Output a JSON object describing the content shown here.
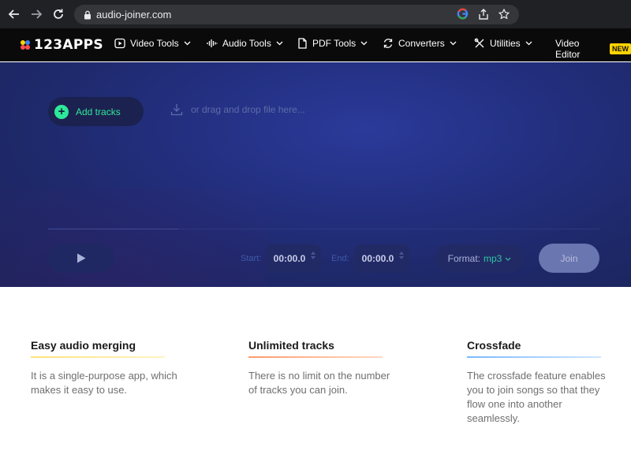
{
  "browser": {
    "url": "audio-joiner.com",
    "icons": [
      "back-arrow-icon",
      "forward-arrow-icon",
      "reload-icon",
      "lock-icon",
      "google-icon",
      "share-icon",
      "star-icon"
    ]
  },
  "header": {
    "logo_text": "123APPS",
    "nav": [
      {
        "label": "Video Tools"
      },
      {
        "label": "Audio Tools"
      },
      {
        "label": "PDF Tools"
      },
      {
        "label": "Converters"
      },
      {
        "label": "Utilities"
      },
      {
        "label": "Video Editor"
      }
    ],
    "new_badge": "NEW"
  },
  "hero": {
    "add_tracks_label": "Add tracks",
    "drop_hint": "or drag and drop file here...",
    "start_label": "Start:",
    "start_value": "00:00.0",
    "end_label": "End:",
    "end_value": "00:00.0",
    "format_label": "Format:",
    "format_value": "mp3",
    "join_label": "Join"
  },
  "features": [
    {
      "title": "Easy audio merging",
      "text": "It is a single-purpose app, which makes it easy to use."
    },
    {
      "title": "Unlimited tracks",
      "text": "There is no limit on the number of tracks you can join."
    },
    {
      "title": "Crossfade",
      "text": "The crossfade feature enables you to join songs so that they flow one into another seamlessly."
    }
  ],
  "colors": {
    "accent_green": "#2ee89a",
    "badge_yellow": "#ffd400",
    "hero_blue": "#243184"
  }
}
